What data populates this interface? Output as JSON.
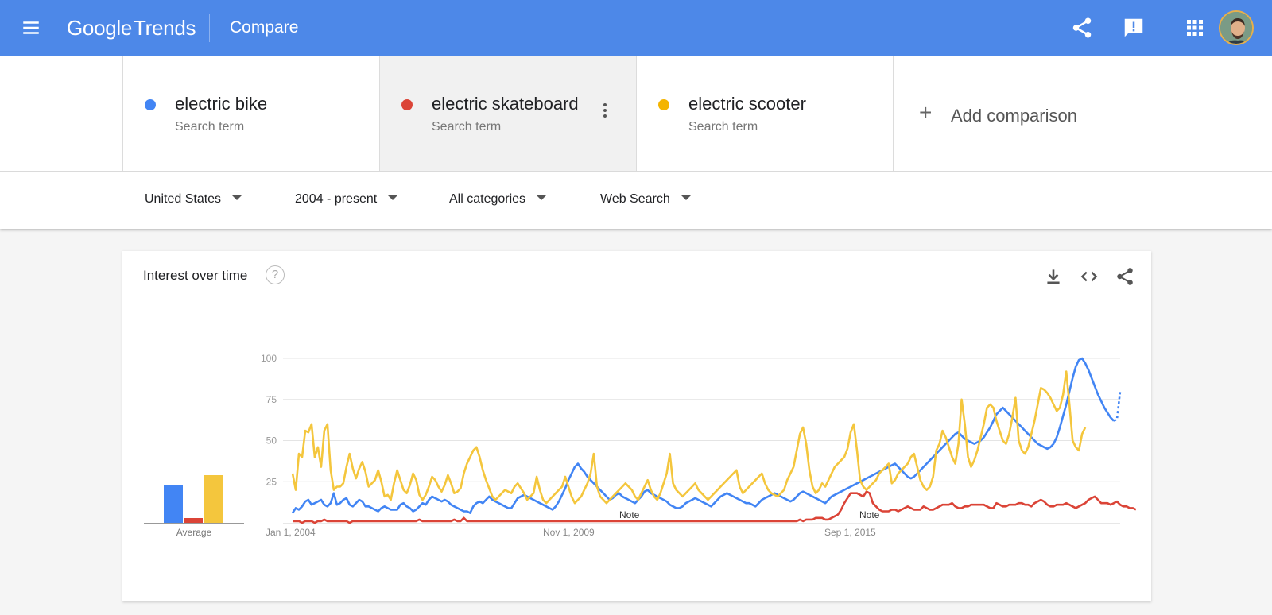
{
  "header": {
    "logo_google": "Google",
    "logo_trends": "Trends",
    "title": "Compare",
    "icons": [
      "menu-icon",
      "share-icon",
      "feedback-icon",
      "apps-grid-icon"
    ],
    "accent_color": "#4d88e8"
  },
  "terms": [
    {
      "name": "electric bike",
      "type": "Search term",
      "color": "#4285f4"
    },
    {
      "name": "electric skateboard",
      "type": "Search term",
      "color": "#db4437"
    },
    {
      "name": "electric scooter",
      "type": "Search term",
      "color": "#f4b400"
    }
  ],
  "add_comparison": {
    "icon": "+",
    "label": "Add comparison"
  },
  "filters": {
    "region": "United States",
    "time": "2004 - present",
    "category": "All categories",
    "search_type": "Web Search"
  },
  "card": {
    "title": "Interest over time",
    "help": "?",
    "average_label": "Average",
    "tools": [
      "download-icon",
      "embed-code-icon",
      "share-icon"
    ]
  },
  "chart_data": {
    "type": "line",
    "x_tick_labels": [
      "Jan 1, 2004",
      "Nov 1, 2009",
      "Sep 1, 2015"
    ],
    "y_ticks": [
      25,
      50,
      75,
      100
    ],
    "ylim": [
      0,
      100
    ],
    "grid": true,
    "notes": [
      "Note",
      "Note"
    ],
    "averages": {
      "electric bike": 23,
      "electric skateboard": 3,
      "electric scooter": 29
    },
    "series": [
      {
        "name": "electric bike",
        "color": "#4285f4",
        "values": [
          6,
          9,
          8,
          10,
          13,
          14,
          11,
          12,
          13,
          14,
          11,
          10,
          12,
          18,
          11,
          12,
          14,
          15,
          11,
          10,
          12,
          14,
          13,
          10,
          10,
          9,
          8,
          7,
          9,
          10,
          9,
          8,
          8,
          8,
          11,
          12,
          10,
          9,
          7,
          8,
          10,
          12,
          11,
          14,
          16,
          15,
          14,
          13,
          14,
          13,
          11,
          10,
          9,
          8,
          7,
          7,
          6,
          10,
          12,
          13,
          12,
          14,
          16,
          14,
          13,
          12,
          11,
          10,
          9,
          9,
          12,
          15,
          16,
          17,
          16,
          15,
          14,
          13,
          12,
          11,
          10,
          9,
          8,
          10,
          13,
          17,
          21,
          26,
          30,
          34,
          36,
          33,
          31,
          28,
          26,
          24,
          22,
          20,
          18,
          16,
          14,
          15,
          17,
          18,
          16,
          15,
          14,
          13,
          12,
          14,
          16,
          19,
          20,
          18,
          17,
          16,
          15,
          14,
          13,
          11,
          10,
          9,
          9,
          10,
          12,
          13,
          14,
          15,
          14,
          13,
          12,
          11,
          10,
          12,
          14,
          16,
          17,
          18,
          17,
          16,
          15,
          14,
          13,
          12,
          12,
          11,
          10,
          12,
          14,
          15,
          16,
          17,
          18,
          17,
          16,
          15,
          14,
          13,
          14,
          16,
          18,
          19,
          18,
          17,
          16,
          15,
          14,
          13,
          12,
          14,
          16,
          17,
          18,
          19,
          20,
          21,
          22,
          23,
          24,
          25,
          26,
          27,
          28,
          29,
          30,
          31,
          32,
          33,
          34,
          35,
          36,
          34,
          32,
          30,
          28,
          27,
          28,
          30,
          32,
          34,
          36,
          38,
          40,
          42,
          44,
          46,
          48,
          50,
          52,
          54,
          55,
          53,
          51,
          50,
          49,
          48,
          49,
          50,
          52,
          55,
          58,
          62,
          66,
          68,
          70,
          68,
          66,
          64,
          62,
          60,
          58,
          56,
          54,
          52,
          50,
          48,
          47,
          46,
          45,
          46,
          48,
          52,
          58,
          65,
          72,
          80,
          88,
          95,
          99,
          100,
          97,
          93,
          88,
          83,
          78,
          74,
          70,
          67,
          64,
          62,
          63,
          80
        ]
      },
      {
        "name": "electric skateboard",
        "color": "#db4437",
        "values": [
          1,
          1,
          1,
          0,
          1,
          1,
          1,
          0,
          1,
          1,
          2,
          1,
          1,
          1,
          1,
          1,
          1,
          1,
          0,
          1,
          1,
          1,
          1,
          1,
          1,
          1,
          1,
          1,
          1,
          1,
          1,
          1,
          1,
          1,
          1,
          1,
          1,
          1,
          1,
          1,
          2,
          1,
          1,
          1,
          1,
          1,
          1,
          1,
          1,
          1,
          1,
          2,
          1,
          1,
          3,
          1,
          1,
          1,
          1,
          1,
          1,
          1,
          1,
          1,
          1,
          1,
          1,
          1,
          1,
          1,
          1,
          1,
          1,
          1,
          1,
          1,
          1,
          1,
          1,
          1,
          1,
          1,
          1,
          1,
          1,
          1,
          1,
          1,
          1,
          1,
          1,
          1,
          1,
          1,
          1,
          1,
          1,
          1,
          1,
          1,
          1,
          1,
          1,
          1,
          1,
          1,
          1,
          1,
          1,
          1,
          1,
          1,
          1,
          1,
          1,
          1,
          1,
          1,
          1,
          1,
          1,
          1,
          1,
          1,
          1,
          1,
          1,
          1,
          1,
          1,
          1,
          1,
          1,
          1,
          1,
          1,
          1,
          1,
          1,
          1,
          1,
          1,
          1,
          1,
          1,
          1,
          1,
          1,
          1,
          1,
          1,
          1,
          1,
          1,
          1,
          1,
          1,
          1,
          1,
          1,
          2,
          1,
          2,
          2,
          2,
          3,
          3,
          3,
          2,
          2,
          3,
          4,
          5,
          8,
          12,
          15,
          18,
          18,
          18,
          17,
          16,
          19,
          18,
          12,
          10,
          8,
          7,
          7,
          7,
          8,
          8,
          7,
          8,
          9,
          10,
          9,
          8,
          8,
          8,
          10,
          9,
          8,
          8,
          9,
          10,
          11,
          11,
          11,
          12,
          10,
          9,
          9,
          10,
          10,
          11,
          11,
          11,
          11,
          11,
          10,
          9,
          9,
          12,
          11,
          10,
          10,
          11,
          11,
          11,
          12,
          12,
          11,
          11,
          10,
          12,
          13,
          14,
          13,
          11,
          10,
          10,
          11,
          11,
          11,
          12,
          11,
          10,
          9,
          10,
          11,
          12,
          14,
          15,
          16,
          14,
          12,
          12,
          12,
          11,
          12,
          13,
          11,
          10,
          10,
          9,
          9,
          8
        ]
      },
      {
        "name": "electric scooter",
        "color": "#f4c63d",
        "values": [
          30,
          20,
          42,
          40,
          56,
          55,
          60,
          40,
          46,
          34,
          56,
          60,
          32,
          20,
          22,
          22,
          24,
          34,
          42,
          33,
          27,
          33,
          37,
          31,
          22,
          24,
          26,
          32,
          25,
          16,
          17,
          14,
          24,
          32,
          26,
          20,
          18,
          23,
          30,
          26,
          17,
          14,
          17,
          22,
          28,
          26,
          22,
          19,
          23,
          29,
          24,
          18,
          19,
          21,
          30,
          36,
          40,
          44,
          46,
          40,
          32,
          26,
          21,
          16,
          14,
          16,
          18,
          20,
          19,
          18,
          22,
          24,
          21,
          18,
          14,
          16,
          18,
          28,
          20,
          14,
          12,
          14,
          16,
          18,
          20,
          22,
          28,
          22,
          16,
          12,
          14,
          16,
          20,
          24,
          30,
          42,
          22,
          16,
          14,
          12,
          14,
          16,
          18,
          20,
          22,
          24,
          22,
          20,
          16,
          14,
          18,
          22,
          26,
          20,
          16,
          14,
          18,
          24,
          30,
          42,
          24,
          20,
          18,
          16,
          18,
          20,
          22,
          24,
          20,
          18,
          16,
          14,
          16,
          18,
          20,
          22,
          24,
          26,
          28,
          30,
          32,
          22,
          18,
          20,
          22,
          24,
          26,
          28,
          30,
          24,
          20,
          18,
          17,
          16,
          18,
          20,
          26,
          30,
          34,
          44,
          54,
          58,
          48,
          32,
          22,
          18,
          20,
          24,
          22,
          26,
          30,
          34,
          36,
          38,
          40,
          45,
          55,
          60,
          44,
          26,
          22,
          20,
          22,
          24,
          26,
          30,
          32,
          34,
          36,
          24,
          26,
          30,
          32,
          34,
          36,
          40,
          42,
          34,
          26,
          22,
          20,
          22,
          28,
          44,
          48,
          56,
          52,
          46,
          40,
          36,
          48,
          75,
          60,
          40,
          34,
          38,
          44,
          52,
          60,
          70,
          72,
          70,
          62,
          56,
          50,
          48,
          54,
          64,
          76,
          50,
          44,
          42,
          46,
          54,
          62,
          72,
          82,
          81,
          79,
          76,
          72,
          68,
          70,
          78,
          92,
          72,
          50,
          46,
          44,
          54,
          58
        ]
      }
    ]
  }
}
